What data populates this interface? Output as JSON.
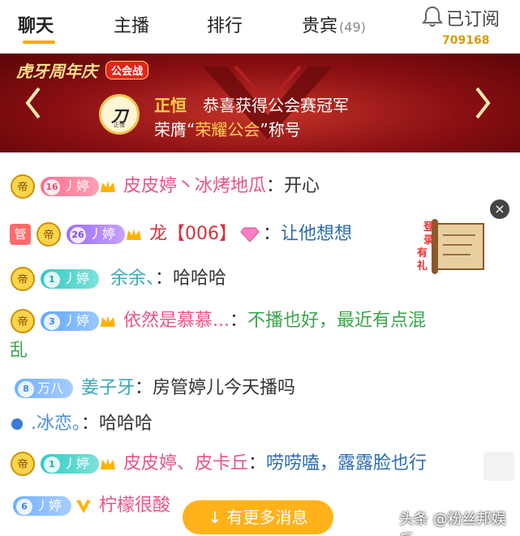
{
  "tabs": [
    {
      "label": "聊天",
      "active": true
    },
    {
      "label": "主播",
      "active": false
    },
    {
      "label": "排行",
      "active": false
    },
    {
      "label": "贵宾",
      "count": "(49)",
      "active": false
    }
  ],
  "follow": {
    "label": "已订阅",
    "count": "709168",
    "icon": "bell-icon"
  },
  "banner": {
    "title": "虎牙周年庆",
    "tag": "公会战",
    "logo_mark": "刀",
    "logo_sub": "正恒",
    "name": "正恒",
    "line1": "恭喜获得公会赛冠军",
    "line2_prefix": "荣膺“",
    "guild": "荣耀公会",
    "line2_suffix": "”称号"
  },
  "messages": [
    {
      "level": "16",
      "fan": "丿婷",
      "name": "皮皮婷丶冰烤地瓜",
      "sep": "：",
      "text": "开心"
    },
    {
      "manager": "管",
      "level": "26",
      "fan": "丿婷",
      "name": "龙【006】",
      "sep": "：",
      "text": "让他想想"
    },
    {
      "level": "1",
      "fan": "丿婷",
      "name": "余余、",
      "sep": "：",
      "text": "哈哈哈"
    },
    {
      "level": "3",
      "fan": "丿婷",
      "name": "依然是慕慕...",
      "sep": "：",
      "text": "不播也好，最近有点混",
      "text2": "乱"
    },
    {
      "level": "8",
      "fan": "万八",
      "name": "姜子牙",
      "sep": "：",
      "text": "房管婷儿今天播吗"
    },
    {
      "name": ".冰恋。",
      "sep": "：",
      "text": "哈哈哈"
    },
    {
      "level": "1",
      "fan": "丿婷",
      "name": "皮皮婷、皮卡丘",
      "sep": "：",
      "text": "唠唠嗑，露露脸也行"
    },
    {
      "level": "6",
      "fan": "丿婷",
      "name": "柠檬很酸"
    }
  ],
  "gift_scroll": {
    "label": "登录有礼"
  },
  "close_label": "×",
  "more_button": "↓ 有更多消息",
  "watermark": "头条 @粉丝邦娱乐"
}
